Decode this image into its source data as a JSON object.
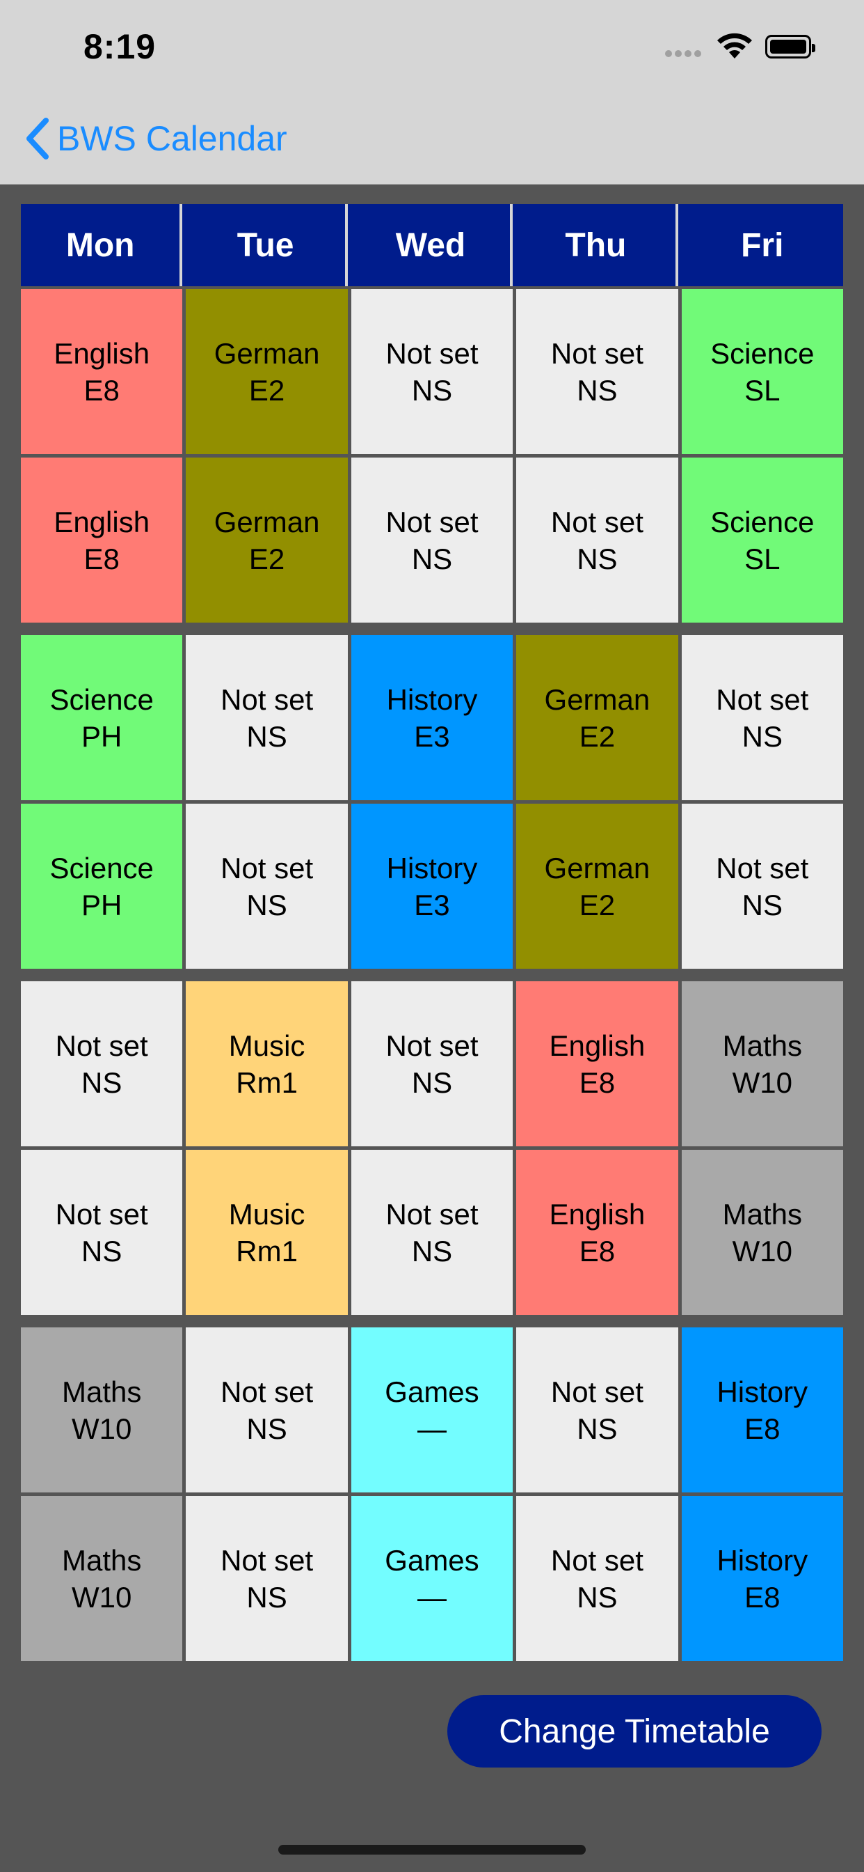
{
  "status_bar": {
    "time": "8:19"
  },
  "nav": {
    "back_label": "BWS Calendar"
  },
  "timetable": {
    "days": [
      "Mon",
      "Tue",
      "Wed",
      "Thu",
      "Fri"
    ],
    "groups": [
      [
        [
          {
            "subject": "English",
            "room": "E8",
            "color": "#ff7b74"
          },
          {
            "subject": "German",
            "room": "E2",
            "color": "#928f00"
          },
          {
            "subject": "Not set",
            "room": "NS",
            "color": "#ededed"
          },
          {
            "subject": "Not set",
            "room": "NS",
            "color": "#ededed"
          },
          {
            "subject": "Science",
            "room": "SL",
            "color": "#71fa78"
          }
        ],
        [
          {
            "subject": "English",
            "room": "E8",
            "color": "#ff7b74"
          },
          {
            "subject": "German",
            "room": "E2",
            "color": "#928f00"
          },
          {
            "subject": "Not set",
            "room": "NS",
            "color": "#ededed"
          },
          {
            "subject": "Not set",
            "room": "NS",
            "color": "#ededed"
          },
          {
            "subject": "Science",
            "room": "SL",
            "color": "#71fa78"
          }
        ]
      ],
      [
        [
          {
            "subject": "Science",
            "room": "PH",
            "color": "#71fa78"
          },
          {
            "subject": "Not set",
            "room": "NS",
            "color": "#ededed"
          },
          {
            "subject": "History",
            "room": "E3",
            "color": "#0096ff"
          },
          {
            "subject": "German",
            "room": "E2",
            "color": "#928f00"
          },
          {
            "subject": "Not set",
            "room": "NS",
            "color": "#ededed"
          }
        ],
        [
          {
            "subject": "Science",
            "room": "PH",
            "color": "#71fa78"
          },
          {
            "subject": "Not set",
            "room": "NS",
            "color": "#ededed"
          },
          {
            "subject": "History",
            "room": "E3",
            "color": "#0096ff"
          },
          {
            "subject": "German",
            "room": "E2",
            "color": "#928f00"
          },
          {
            "subject": "Not set",
            "room": "NS",
            "color": "#ededed"
          }
        ]
      ],
      [
        [
          {
            "subject": "Not set",
            "room": "NS",
            "color": "#ededed"
          },
          {
            "subject": "Music",
            "room": "Rm1",
            "color": "#ffd479"
          },
          {
            "subject": "Not set",
            "room": "NS",
            "color": "#ededed"
          },
          {
            "subject": "English",
            "room": "E8",
            "color": "#ff7b74"
          },
          {
            "subject": "Maths",
            "room": "W10",
            "color": "#a9a9a9"
          }
        ],
        [
          {
            "subject": "Not set",
            "room": "NS",
            "color": "#ededed"
          },
          {
            "subject": "Music",
            "room": "Rm1",
            "color": "#ffd479"
          },
          {
            "subject": "Not set",
            "room": "NS",
            "color": "#ededed"
          },
          {
            "subject": "English",
            "room": "E8",
            "color": "#ff7b74"
          },
          {
            "subject": "Maths",
            "room": "W10",
            "color": "#a9a9a9"
          }
        ]
      ],
      [
        [
          {
            "subject": "Maths",
            "room": "W10",
            "color": "#a9a9a9"
          },
          {
            "subject": "Not set",
            "room": "NS",
            "color": "#ededed"
          },
          {
            "subject": "Games",
            "room": "—",
            "color": "#73fdff"
          },
          {
            "subject": "Not set",
            "room": "NS",
            "color": "#ededed"
          },
          {
            "subject": "History",
            "room": "E8",
            "color": "#0096ff"
          }
        ],
        [
          {
            "subject": "Maths",
            "room": "W10",
            "color": "#a9a9a9"
          },
          {
            "subject": "Not set",
            "room": "NS",
            "color": "#ededed"
          },
          {
            "subject": "Games",
            "room": "—",
            "color": "#73fdff"
          },
          {
            "subject": "Not set",
            "room": "NS",
            "color": "#ededed"
          },
          {
            "subject": "History",
            "room": "E8",
            "color": "#0096ff"
          }
        ]
      ]
    ]
  },
  "actions": {
    "change_timetable_label": "Change Timetable"
  },
  "colors": {
    "header_bg": "#001c8c",
    "background": "#555555",
    "accent": "#1a8cff"
  }
}
